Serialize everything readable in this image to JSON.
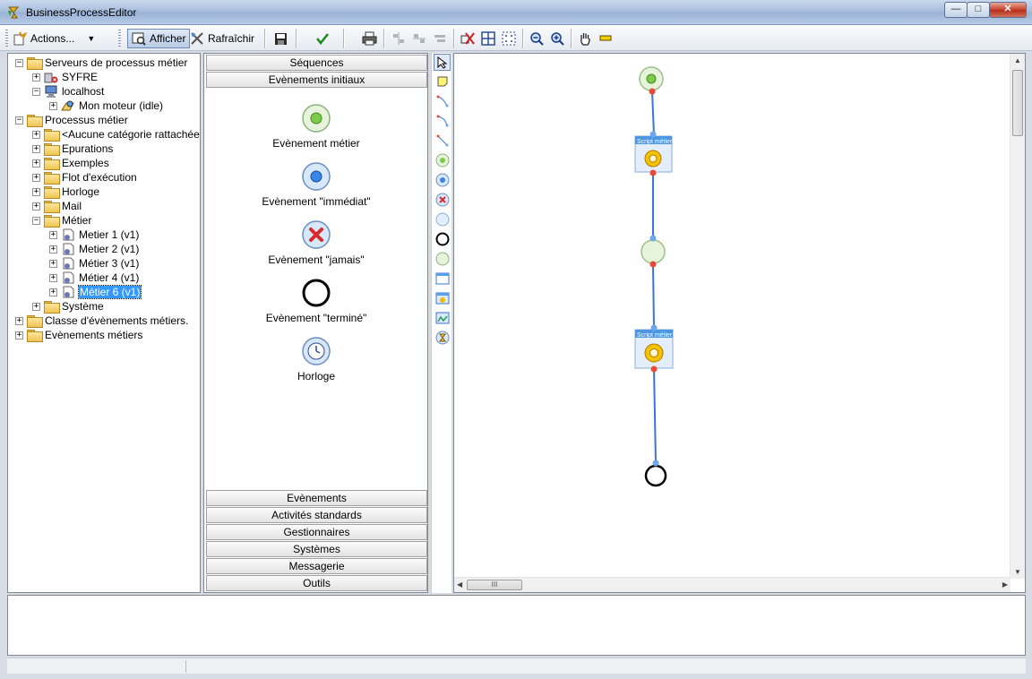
{
  "window": {
    "title": "BusinessProcessEditor"
  },
  "toolbar": {
    "actions_label": "Actions...",
    "afficher_label": "Afficher",
    "rafraichir_label": "Rafraîchir"
  },
  "tree": {
    "items": [
      {
        "label": "Serveurs de processus métier"
      },
      {
        "label": "SYFRE"
      },
      {
        "label": "localhost"
      },
      {
        "label": "Mon moteur (idle)"
      },
      {
        "label": "Processus métier"
      },
      {
        "label": "<Aucune catégorie rattachée>"
      },
      {
        "label": "Epurations"
      },
      {
        "label": "Exemples"
      },
      {
        "label": "Flot d'exécution"
      },
      {
        "label": "Horloge"
      },
      {
        "label": "Mail"
      },
      {
        "label": "Métier"
      },
      {
        "label": "Metier 1 (v1)"
      },
      {
        "label": "Metier 2 (v1)"
      },
      {
        "label": "Métier 3 (v1)"
      },
      {
        "label": "Métier 4 (v1)"
      },
      {
        "label": "Métier 6 (v1)"
      },
      {
        "label": "Système"
      },
      {
        "label": "Classe d'évènements métiers."
      },
      {
        "label": "Evènements métiers"
      }
    ]
  },
  "palette": {
    "top_sections": [
      "Séquences",
      "Evènements initiaux"
    ],
    "items": [
      {
        "label": "Evènement métier"
      },
      {
        "label": "Evènement \"immédiat\""
      },
      {
        "label": "Evènement \"jamais\""
      },
      {
        "label": "Evènement \"terminé\""
      },
      {
        "label": "Horloge"
      }
    ],
    "bottom_sections": [
      "Evènements",
      "Activités standards",
      "Gestionnaires",
      "Systèmes",
      "Messagerie",
      "Outils"
    ]
  },
  "canvas": {
    "task1_label": "Script métier",
    "task2_label": "Script métier",
    "hscroll_grip": "III"
  },
  "colors": {
    "flow_line": "#3a74d8",
    "port_in": "#6ea6ee",
    "port_out": "#e84a3a",
    "start_event": "#8fd16a",
    "end_event": "#000000"
  }
}
